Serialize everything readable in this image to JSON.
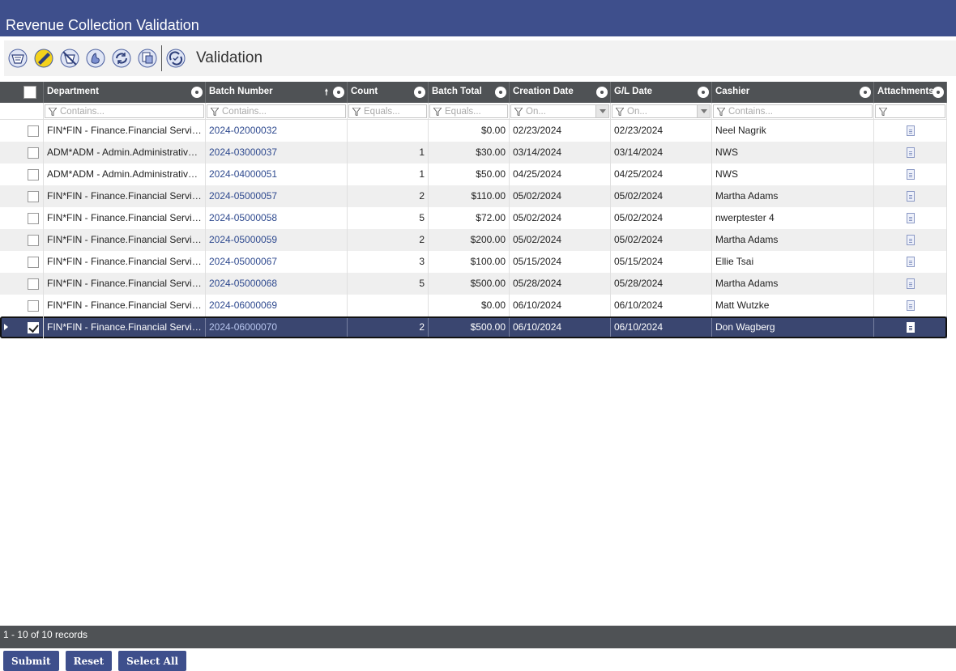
{
  "app": {
    "title": "Revenue Collection Validation"
  },
  "toolbar": {
    "icons": [
      "list-icon",
      "approve-icon",
      "reject-icon",
      "hand-icon",
      "refresh-icon",
      "print-icon",
      "validation-icon"
    ],
    "label": "Validation"
  },
  "grid": {
    "columns": [
      {
        "label": "Department",
        "filter": "Contains..."
      },
      {
        "label": "Batch Number",
        "filter": "Contains...",
        "sorted": "ascending"
      },
      {
        "label": "Count",
        "filter": "Equals..."
      },
      {
        "label": "Batch Total",
        "filter": "Equals..."
      },
      {
        "label": "Creation Date",
        "filter": "On..."
      },
      {
        "label": "G/L Date",
        "filter": "On..."
      },
      {
        "label": "Cashier",
        "filter": "Contains..."
      },
      {
        "label": "Attachments",
        "filter": ""
      }
    ],
    "rows": [
      {
        "department": "FIN*FIN - Finance.Financial Services",
        "batch": "2024-02000032",
        "count": "",
        "total": "$0.00",
        "created": "02/23/2024",
        "gl": "02/23/2024",
        "cashier": "Neel Nagrik",
        "checked": false
      },
      {
        "department": "ADM*ADM - Admin.Administrative Services",
        "batch": "2024-03000037",
        "count": "1",
        "total": "$30.00",
        "created": "03/14/2024",
        "gl": "03/14/2024",
        "cashier": "NWS",
        "checked": false
      },
      {
        "department": "ADM*ADM - Admin.Administrative Services",
        "batch": "2024-04000051",
        "count": "1",
        "total": "$50.00",
        "created": "04/25/2024",
        "gl": "04/25/2024",
        "cashier": "NWS",
        "checked": false
      },
      {
        "department": "FIN*FIN - Finance.Financial Services",
        "batch": "2024-05000057",
        "count": "2",
        "total": "$110.00",
        "created": "05/02/2024",
        "gl": "05/02/2024",
        "cashier": "Martha Adams",
        "checked": false
      },
      {
        "department": "FIN*FIN - Finance.Financial Services",
        "batch": "2024-05000058",
        "count": "5",
        "total": "$72.00",
        "created": "05/02/2024",
        "gl": "05/02/2024",
        "cashier": "nwerptester 4",
        "checked": false
      },
      {
        "department": "FIN*FIN - Finance.Financial Services",
        "batch": "2024-05000059",
        "count": "2",
        "total": "$200.00",
        "created": "05/02/2024",
        "gl": "05/02/2024",
        "cashier": "Martha Adams",
        "checked": false
      },
      {
        "department": "FIN*FIN - Finance.Financial Services",
        "batch": "2024-05000067",
        "count": "3",
        "total": "$100.00",
        "created": "05/15/2024",
        "gl": "05/15/2024",
        "cashier": "Ellie Tsai",
        "checked": false
      },
      {
        "department": "FIN*FIN - Finance.Financial Services",
        "batch": "2024-05000068",
        "count": "5",
        "total": "$500.00",
        "created": "05/28/2024",
        "gl": "05/28/2024",
        "cashier": "Martha Adams",
        "checked": false
      },
      {
        "department": "FIN*FIN - Finance.Financial Services",
        "batch": "2024-06000069",
        "count": "",
        "total": "$0.00",
        "created": "06/10/2024",
        "gl": "06/10/2024",
        "cashier": "Matt Wutzke",
        "checked": false
      },
      {
        "department": "FIN*FIN - Finance.Financial Services",
        "batch": "2024-06000070",
        "count": "2",
        "total": "$500.00",
        "created": "06/10/2024",
        "gl": "06/10/2024",
        "cashier": "Don Wagberg",
        "checked": true,
        "selected": true
      }
    ]
  },
  "footer": {
    "record_count": "1 - 10 of 10 records"
  },
  "buttons": {
    "submit": "Submit",
    "reset": "Reset",
    "select_all": "Select All"
  },
  "colors": {
    "header": "#3e4f8c",
    "grid_header": "#4f5255",
    "selected_row": "#3a4670",
    "link": "#2f4a8f"
  }
}
